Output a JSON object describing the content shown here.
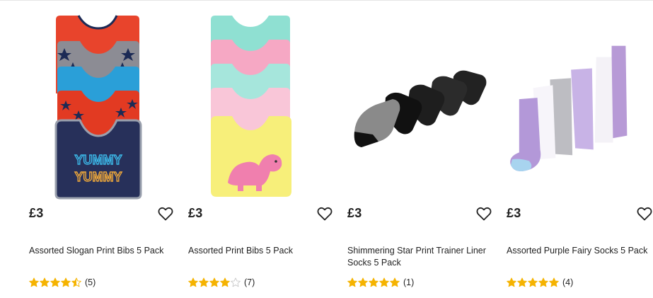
{
  "products": [
    {
      "price": "£3",
      "title": "Assorted Slogan Print Bibs 5 Pack",
      "rating": 4.5,
      "rating_count": "(5)",
      "image": "assorted-slogan-bibs-image"
    },
    {
      "price": "£3",
      "title": "Assorted Print Bibs 5 Pack",
      "rating": 4,
      "rating_count": "(7)",
      "image": "assorted-print-bibs-image"
    },
    {
      "price": "£3",
      "title": "Shimmering Star Print Trainer Liner Socks 5 Pack",
      "rating": 5,
      "rating_count": "(1)",
      "image": "star-trainer-socks-image"
    },
    {
      "price": "£3",
      "title": "Assorted Purple Fairy Socks 5 Pack",
      "rating": 5,
      "rating_count": "(4)",
      "image": "purple-fairy-socks-image"
    }
  ],
  "icons": {
    "wishlist": "heart-outline-icon",
    "star": "star-icon"
  },
  "colors": {
    "star": "#f5b301",
    "star_empty": "#c8c8c8",
    "text": "#222222"
  }
}
